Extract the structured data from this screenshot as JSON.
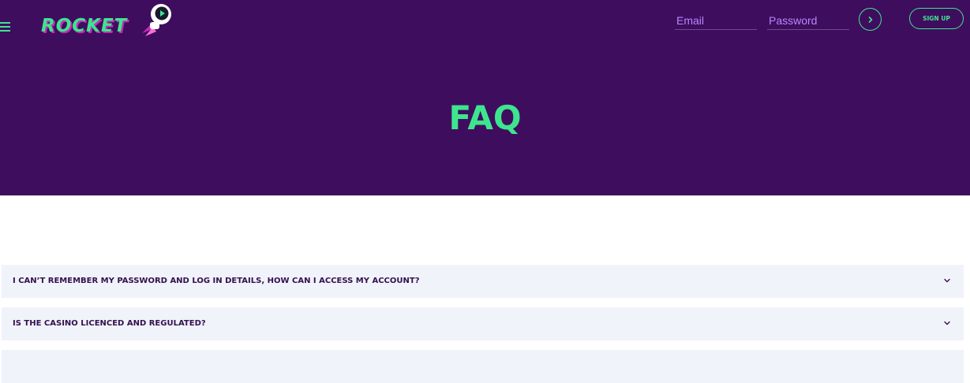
{
  "header": {
    "brand_name": "ROCKET",
    "email_placeholder": "Email",
    "password_placeholder": "Password",
    "signup_label": "SIGN UP"
  },
  "hero": {
    "title": "FAQ"
  },
  "faq": {
    "items": [
      {
        "question": "I CAN’T REMEMBER MY PASSWORD AND LOG IN DETAILS, HOW CAN I ACCESS MY ACCOUNT?"
      },
      {
        "question": "IS THE CASINO LICENCED AND REGULATED?"
      },
      {
        "question": ""
      }
    ]
  },
  "icons": {
    "menu": "hamburger-menu-icon",
    "mascot": "astronaut-rocket-icon",
    "submit": "chevron-right-icon",
    "expand": "chevron-down-icon"
  },
  "colors": {
    "hero_background": "#3f0d5e",
    "accent_green": "#3ee58f",
    "accent_purple": "#b489ff",
    "faq_background": "#f0f3fa",
    "faq_text": "#33104e"
  }
}
